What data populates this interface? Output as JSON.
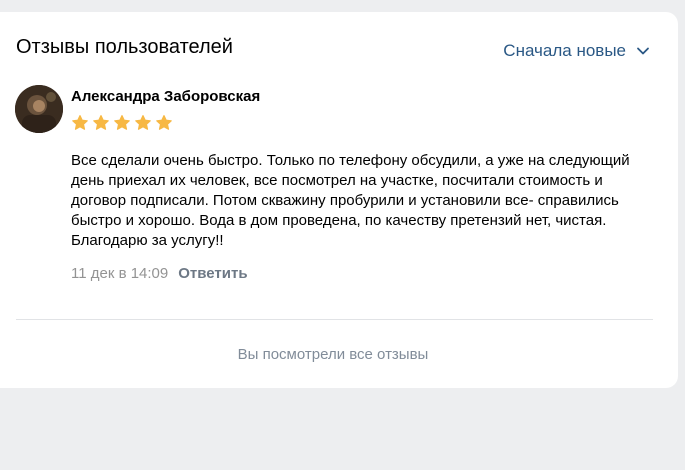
{
  "panel": {
    "title": "Отзывы пользователей",
    "sort_label": "Сначала новые",
    "sort_icon": "chevron-down-icon"
  },
  "review": {
    "author": "Александра Заборовская",
    "avatar_icon": "user-avatar",
    "rating": 5,
    "rating_max": 5,
    "star_color": "#f7b844",
    "text": "Все сделали очень быстро. Только по телефону обсудили, а уже на следующий день приехал их человек, все посмотрел на участке, посчитали стоимость и договор подписали. Потом скважину пробурили и установили все- справились быстро и хорошо. Вода в дом проведена, по качеству претензий нет, чистая. Благодарю за услугу!!",
    "timestamp": "11 дек в 14:09",
    "reply_label": "Ответить"
  },
  "footer": {
    "message": "Вы посмотрели все отзывы"
  },
  "colors": {
    "background": "#edeef0",
    "card": "#ffffff",
    "link": "#2a5885",
    "meta": "#939393",
    "divider": "#e1e3e6"
  }
}
